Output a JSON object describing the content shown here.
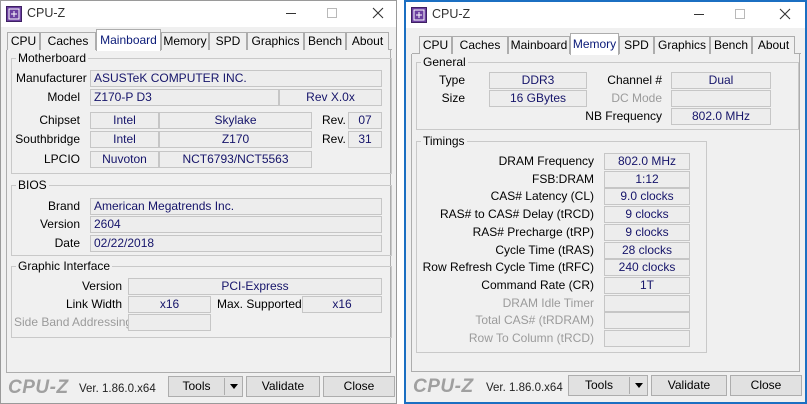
{
  "windows": [
    {
      "title": "CPU-Z",
      "tabs": [
        "CPU",
        "Caches",
        "Mainboard",
        "Memory",
        "SPD",
        "Graphics",
        "Bench",
        "About"
      ],
      "active_tab": "Mainboard",
      "motherboard": {
        "group_title": "Motherboard",
        "manufacturer_label": "Manufacturer",
        "manufacturer": "ASUSTeK COMPUTER INC.",
        "model_label": "Model",
        "model": "Z170-P D3",
        "model_rev": "Rev X.0x",
        "chipset_label": "Chipset",
        "chipset_vendor": "Intel",
        "chipset_name": "Skylake",
        "chipset_rev_label": "Rev.",
        "chipset_rev": "07",
        "southbridge_label": "Southbridge",
        "southbridge_vendor": "Intel",
        "southbridge_name": "Z170",
        "southbridge_rev_label": "Rev.",
        "southbridge_rev": "31",
        "lpcio_label": "LPCIO",
        "lpcio_vendor": "Nuvoton",
        "lpcio_name": "NCT6793/NCT5563"
      },
      "bios": {
        "group_title": "BIOS",
        "brand_label": "Brand",
        "brand": "American Megatrends Inc.",
        "version_label": "Version",
        "version": "2604",
        "date_label": "Date",
        "date": "02/22/2018"
      },
      "graphic_interface": {
        "group_title": "Graphic Interface",
        "version_label": "Version",
        "version": "PCI-Express",
        "link_width_label": "Link Width",
        "link_width": "x16",
        "max_supported_label": "Max. Supported",
        "max_supported": "x16",
        "side_band_label": "Side Band Addressing",
        "side_band": ""
      },
      "footer": {
        "logo": "CPU-Z",
        "version": "Ver. 1.86.0.x64",
        "tools": "Tools",
        "validate": "Validate",
        "close": "Close"
      }
    },
    {
      "title": "CPU-Z",
      "tabs": [
        "CPU",
        "Caches",
        "Mainboard",
        "Memory",
        "SPD",
        "Graphics",
        "Bench",
        "About"
      ],
      "active_tab": "Memory",
      "general": {
        "group_title": "General",
        "type_label": "Type",
        "type": "DDR3",
        "size_label": "Size",
        "size": "16 GBytes",
        "channel_label": "Channel #",
        "channel": "Dual",
        "dc_mode_label": "DC Mode",
        "dc_mode": "",
        "nb_freq_label": "NB Frequency",
        "nb_freq": "802.0 MHz"
      },
      "timings": {
        "group_title": "Timings",
        "rows": [
          {
            "label": "DRAM Frequency",
            "value": "802.0 MHz",
            "enabled": true
          },
          {
            "label": "FSB:DRAM",
            "value": "1:12",
            "enabled": true
          },
          {
            "label": "CAS# Latency (CL)",
            "value": "9.0 clocks",
            "enabled": true
          },
          {
            "label": "RAS# to CAS# Delay (tRCD)",
            "value": "9 clocks",
            "enabled": true
          },
          {
            "label": "RAS# Precharge (tRP)",
            "value": "9 clocks",
            "enabled": true
          },
          {
            "label": "Cycle Time (tRAS)",
            "value": "28 clocks",
            "enabled": true
          },
          {
            "label": "Row Refresh Cycle Time (tRFC)",
            "value": "240 clocks",
            "enabled": true
          },
          {
            "label": "Command Rate (CR)",
            "value": "1T",
            "enabled": true
          },
          {
            "label": "DRAM Idle Timer",
            "value": "",
            "enabled": false
          },
          {
            "label": "Total CAS# (tRDRAM)",
            "value": "",
            "enabled": false
          },
          {
            "label": "Row To Column (tRCD)",
            "value": "",
            "enabled": false
          }
        ]
      },
      "footer": {
        "logo": "CPU-Z",
        "version": "Ver. 1.86.0.x64",
        "tools": "Tools",
        "validate": "Validate",
        "close": "Close"
      }
    }
  ],
  "colors": {
    "value_text": "#15146a",
    "active_border": "#1b6fc2",
    "logo": "#a0a0a0"
  }
}
